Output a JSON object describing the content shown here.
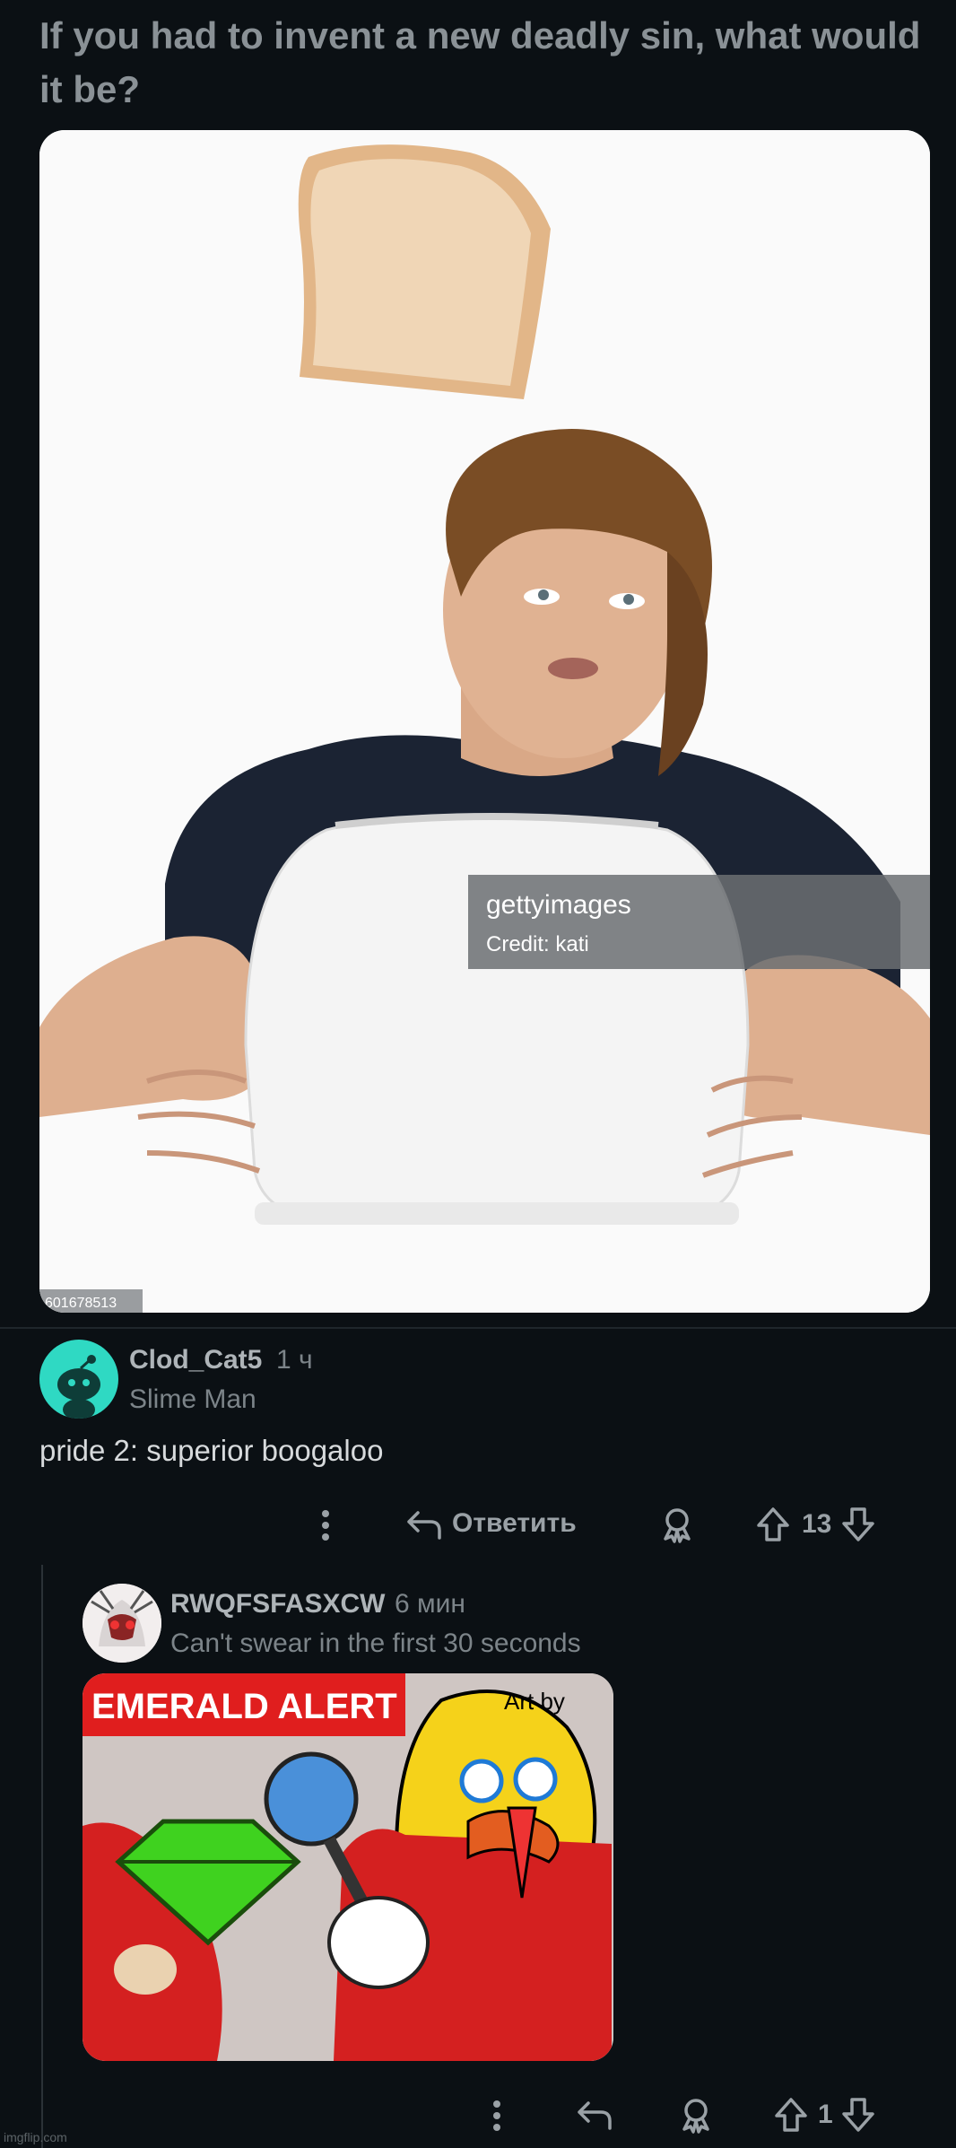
{
  "post": {
    "title": "If you had to invent a new deadly sin, what would it be?",
    "image": {
      "watermark_brand": "gettyimages",
      "watermark_credit": "Credit: kati",
      "image_id": "601678513"
    }
  },
  "comment": {
    "username": "Clod_Cat5",
    "time": "1 ч",
    "flair": "Slime Man",
    "body": "pride 2: superior boogaloo",
    "actions": {
      "more_icon": "more-vertical-icon",
      "reply_label": "Ответить",
      "award_icon": "award-icon",
      "vote_count": "13"
    }
  },
  "reply": {
    "username": "RWQFSFASXCW",
    "time": "6 мин",
    "flair": "Can't swear in the first 30 seconds",
    "image": {
      "banner": "EMERALD ALERT"
    },
    "actions": {
      "vote_count": "1"
    }
  },
  "footer": {
    "watermark": "imgflip.com"
  },
  "colors": {
    "background": "#0b1014",
    "avatar_teal": "#2fd9c3",
    "emerald": "#3fd21f"
  }
}
